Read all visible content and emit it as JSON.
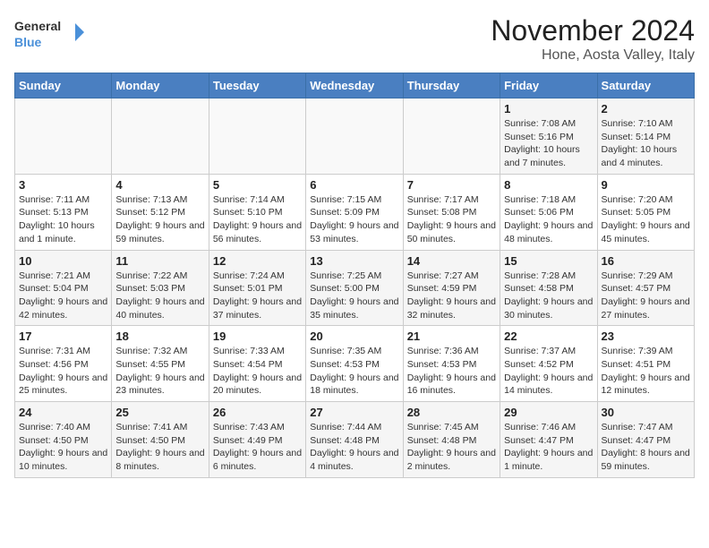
{
  "logo": {
    "general": "General",
    "blue": "Blue"
  },
  "title": "November 2024",
  "location": "Hone, Aosta Valley, Italy",
  "weekdays": [
    "Sunday",
    "Monday",
    "Tuesday",
    "Wednesday",
    "Thursday",
    "Friday",
    "Saturday"
  ],
  "weeks": [
    [
      {
        "day": "",
        "info": ""
      },
      {
        "day": "",
        "info": ""
      },
      {
        "day": "",
        "info": ""
      },
      {
        "day": "",
        "info": ""
      },
      {
        "day": "",
        "info": ""
      },
      {
        "day": "1",
        "info": "Sunrise: 7:08 AM\nSunset: 5:16 PM\nDaylight: 10 hours and 7 minutes."
      },
      {
        "day": "2",
        "info": "Sunrise: 7:10 AM\nSunset: 5:14 PM\nDaylight: 10 hours and 4 minutes."
      }
    ],
    [
      {
        "day": "3",
        "info": "Sunrise: 7:11 AM\nSunset: 5:13 PM\nDaylight: 10 hours and 1 minute."
      },
      {
        "day": "4",
        "info": "Sunrise: 7:13 AM\nSunset: 5:12 PM\nDaylight: 9 hours and 59 minutes."
      },
      {
        "day": "5",
        "info": "Sunrise: 7:14 AM\nSunset: 5:10 PM\nDaylight: 9 hours and 56 minutes."
      },
      {
        "day": "6",
        "info": "Sunrise: 7:15 AM\nSunset: 5:09 PM\nDaylight: 9 hours and 53 minutes."
      },
      {
        "day": "7",
        "info": "Sunrise: 7:17 AM\nSunset: 5:08 PM\nDaylight: 9 hours and 50 minutes."
      },
      {
        "day": "8",
        "info": "Sunrise: 7:18 AM\nSunset: 5:06 PM\nDaylight: 9 hours and 48 minutes."
      },
      {
        "day": "9",
        "info": "Sunrise: 7:20 AM\nSunset: 5:05 PM\nDaylight: 9 hours and 45 minutes."
      }
    ],
    [
      {
        "day": "10",
        "info": "Sunrise: 7:21 AM\nSunset: 5:04 PM\nDaylight: 9 hours and 42 minutes."
      },
      {
        "day": "11",
        "info": "Sunrise: 7:22 AM\nSunset: 5:03 PM\nDaylight: 9 hours and 40 minutes."
      },
      {
        "day": "12",
        "info": "Sunrise: 7:24 AM\nSunset: 5:01 PM\nDaylight: 9 hours and 37 minutes."
      },
      {
        "day": "13",
        "info": "Sunrise: 7:25 AM\nSunset: 5:00 PM\nDaylight: 9 hours and 35 minutes."
      },
      {
        "day": "14",
        "info": "Sunrise: 7:27 AM\nSunset: 4:59 PM\nDaylight: 9 hours and 32 minutes."
      },
      {
        "day": "15",
        "info": "Sunrise: 7:28 AM\nSunset: 4:58 PM\nDaylight: 9 hours and 30 minutes."
      },
      {
        "day": "16",
        "info": "Sunrise: 7:29 AM\nSunset: 4:57 PM\nDaylight: 9 hours and 27 minutes."
      }
    ],
    [
      {
        "day": "17",
        "info": "Sunrise: 7:31 AM\nSunset: 4:56 PM\nDaylight: 9 hours and 25 minutes."
      },
      {
        "day": "18",
        "info": "Sunrise: 7:32 AM\nSunset: 4:55 PM\nDaylight: 9 hours and 23 minutes."
      },
      {
        "day": "19",
        "info": "Sunrise: 7:33 AM\nSunset: 4:54 PM\nDaylight: 9 hours and 20 minutes."
      },
      {
        "day": "20",
        "info": "Sunrise: 7:35 AM\nSunset: 4:53 PM\nDaylight: 9 hours and 18 minutes."
      },
      {
        "day": "21",
        "info": "Sunrise: 7:36 AM\nSunset: 4:53 PM\nDaylight: 9 hours and 16 minutes."
      },
      {
        "day": "22",
        "info": "Sunrise: 7:37 AM\nSunset: 4:52 PM\nDaylight: 9 hours and 14 minutes."
      },
      {
        "day": "23",
        "info": "Sunrise: 7:39 AM\nSunset: 4:51 PM\nDaylight: 9 hours and 12 minutes."
      }
    ],
    [
      {
        "day": "24",
        "info": "Sunrise: 7:40 AM\nSunset: 4:50 PM\nDaylight: 9 hours and 10 minutes."
      },
      {
        "day": "25",
        "info": "Sunrise: 7:41 AM\nSunset: 4:50 PM\nDaylight: 9 hours and 8 minutes."
      },
      {
        "day": "26",
        "info": "Sunrise: 7:43 AM\nSunset: 4:49 PM\nDaylight: 9 hours and 6 minutes."
      },
      {
        "day": "27",
        "info": "Sunrise: 7:44 AM\nSunset: 4:48 PM\nDaylight: 9 hours and 4 minutes."
      },
      {
        "day": "28",
        "info": "Sunrise: 7:45 AM\nSunset: 4:48 PM\nDaylight: 9 hours and 2 minutes."
      },
      {
        "day": "29",
        "info": "Sunrise: 7:46 AM\nSunset: 4:47 PM\nDaylight: 9 hours and 1 minute."
      },
      {
        "day": "30",
        "info": "Sunrise: 7:47 AM\nSunset: 4:47 PM\nDaylight: 8 hours and 59 minutes."
      }
    ]
  ]
}
